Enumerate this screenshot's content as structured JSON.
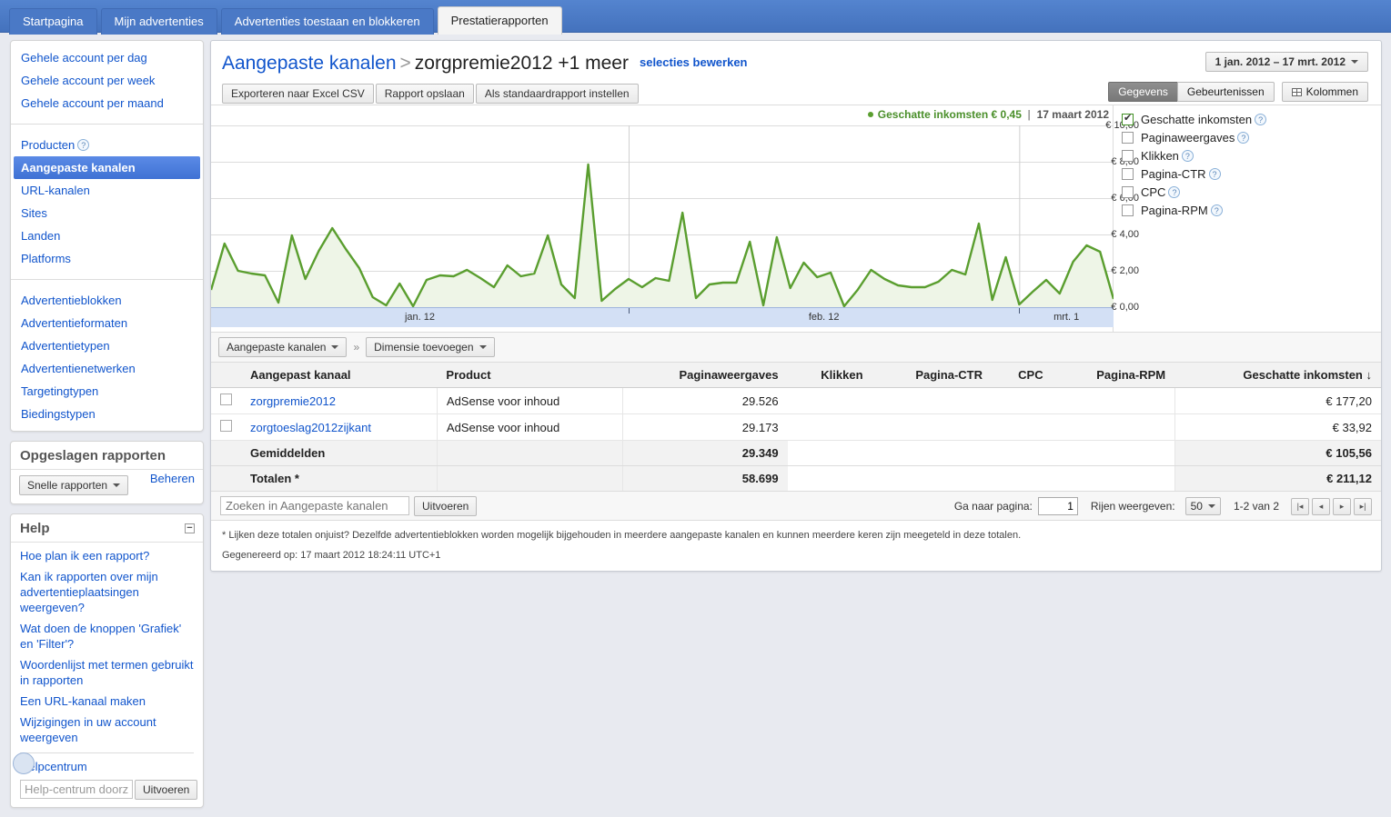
{
  "tabs": [
    {
      "label": "Startpagina",
      "active": false
    },
    {
      "label": "Mijn advertenties",
      "active": false
    },
    {
      "label": "Advertenties toestaan en blokkeren",
      "active": false
    },
    {
      "label": "Prestatierapporten",
      "active": true
    }
  ],
  "sidebar": {
    "nav_group1": [
      {
        "label": "Gehele account per dag"
      },
      {
        "label": "Gehele account per week"
      },
      {
        "label": "Gehele account per maand"
      }
    ],
    "nav_group2": [
      {
        "label": "Producten",
        "help": true
      },
      {
        "label": "Aangepaste kanalen",
        "selected": true
      },
      {
        "label": "URL-kanalen"
      },
      {
        "label": "Sites"
      },
      {
        "label": "Landen"
      },
      {
        "label": "Platforms"
      }
    ],
    "nav_group3": [
      {
        "label": "Advertentieblokken"
      },
      {
        "label": "Advertentieformaten"
      },
      {
        "label": "Advertentietypen"
      },
      {
        "label": "Advertentienetwerken"
      },
      {
        "label": "Targetingtypen"
      },
      {
        "label": "Biedingstypen"
      }
    ],
    "saved_reports": {
      "title": "Opgeslagen rapporten",
      "manage_label": "Beheren",
      "quick_reports_label": "Snelle rapporten"
    },
    "help": {
      "title": "Help",
      "links": [
        "Hoe plan ik een rapport?",
        "Kan ik rapporten over mijn advertentieplaatsingen weergeven?",
        "Wat doen de knoppen 'Grafiek' en 'Filter'?",
        "Woordenlijst met termen gebruikt in rapporten",
        "Een URL-kanaal maken",
        "Wijzigingen in uw account weergeven"
      ],
      "helpcentrum_label": "Helpcentrum",
      "search_placeholder": "Help-centrum doorzoeken",
      "search_button": "Uitvoeren"
    }
  },
  "header": {
    "breadcrumb_root": "Aangepaste kanalen",
    "breadcrumb_sep": ">",
    "breadcrumb_current": "zorgpremie2012 +1 meer",
    "edit_selections": "selecties bewerken",
    "buttons": [
      "Exporteren naar Excel CSV",
      "Rapport opslaan",
      "Als standaardrapport instellen"
    ],
    "date_range": "1 jan. 2012 – 17 mrt. 2012",
    "view_data": "Gegevens",
    "view_events": "Gebeurtenissen",
    "columns_button": "Kolommen"
  },
  "chart_data": {
    "type": "line",
    "title": "Geschatte inkomsten",
    "title_value": "€ 0,45",
    "title_date": "17 maart 2012",
    "xlabel": "",
    "ylabel": "",
    "ylim": [
      0,
      10
    ],
    "ytick_labels": [
      "€ 10,00",
      "€ 8,00",
      "€ 6,00",
      "€ 4,00",
      "€ 2,00",
      "€ 0,00"
    ],
    "yticks": [
      10,
      8,
      6,
      4,
      2,
      0
    ],
    "xtick_labels": [
      "jan. 12",
      "feb. 12",
      "mrt. 1"
    ],
    "xtick_positions": [
      0,
      31,
      60
    ],
    "grid": true,
    "legend": "none",
    "line_color": "#5a9e2f",
    "fill_color": "#eef5e7",
    "series": [
      {
        "name": "Geschatte inkomsten",
        "values": [
          0.95,
          3.5,
          2.0,
          1.85,
          1.75,
          0.25,
          3.95,
          1.55,
          3.1,
          4.35,
          3.2,
          2.15,
          0.55,
          0.1,
          1.3,
          0.05,
          1.5,
          1.75,
          1.7,
          2.05,
          1.6,
          1.1,
          2.3,
          1.7,
          1.85,
          3.95,
          1.25,
          0.5,
          7.85,
          0.35,
          1.0,
          1.55,
          1.1,
          1.6,
          1.45,
          5.2,
          0.5,
          1.25,
          1.35,
          1.35,
          3.6,
          0.1,
          3.85,
          1.05,
          2.45,
          1.65,
          1.9,
          0.05,
          0.95,
          2.05,
          1.55,
          1.2,
          1.1,
          1.1,
          1.4,
          2.05,
          1.8,
          4.6,
          0.4,
          2.75,
          0.15,
          0.85,
          1.5,
          0.75,
          2.5,
          3.4,
          3.05,
          0.45
        ]
      }
    ]
  },
  "metrics": [
    {
      "label": "Geschatte inkomsten",
      "checked": true,
      "help": true
    },
    {
      "label": "Paginaweergaves",
      "checked": false,
      "help": true
    },
    {
      "label": "Klikken",
      "checked": false,
      "help": true
    },
    {
      "label": "Pagina-CTR",
      "checked": false,
      "help": true
    },
    {
      "label": "CPC",
      "checked": false,
      "help": true
    },
    {
      "label": "Pagina-RPM",
      "checked": false,
      "help": true
    }
  ],
  "dimension_bar": {
    "primary": "Aangepaste kanalen",
    "separator": "»",
    "add_dimension": "Dimensie toevoegen"
  },
  "table": {
    "columns": [
      {
        "label": "Aangepast kanaal",
        "align": "left"
      },
      {
        "label": "Product",
        "align": "left"
      },
      {
        "label": "Paginaweergaves",
        "align": "right"
      },
      {
        "label": "Klikken",
        "align": "right"
      },
      {
        "label": "Pagina-CTR",
        "align": "right"
      },
      {
        "label": "CPC",
        "align": "right"
      },
      {
        "label": "Pagina-RPM",
        "align": "right"
      },
      {
        "label": "Geschatte inkomsten ↓",
        "align": "right"
      }
    ],
    "rows": [
      {
        "channel": "zorgpremie2012",
        "product": "AdSense voor inhoud",
        "pageviews": "29.526",
        "clicks": "",
        "page_ctr": "",
        "cpc": "",
        "page_rpm": "",
        "est_earnings": "€ 177,20"
      },
      {
        "channel": "zorgtoeslag2012zijkant",
        "product": "AdSense voor inhoud",
        "pageviews": "29.173",
        "clicks": "",
        "page_ctr": "",
        "cpc": "",
        "page_rpm": "",
        "est_earnings": "€ 33,92"
      }
    ],
    "summary": [
      {
        "label": "Gemiddelden",
        "product": "",
        "pageviews": "29.349",
        "clicks": "",
        "page_ctr": "",
        "cpc": "",
        "page_rpm": "",
        "est_earnings": "€ 105,56"
      },
      {
        "label": "Totalen *",
        "product": "",
        "pageviews": "58.699",
        "clicks": "",
        "page_ctr": "",
        "cpc": "",
        "page_rpm": "",
        "est_earnings": "€ 211,12"
      }
    ]
  },
  "table_footer": {
    "search_placeholder": "Zoeken in Aangepaste kanalen",
    "search_button": "Uitvoeren",
    "goto_page_label": "Ga naar pagina:",
    "page_value": "1",
    "rows_label": "Rijen weergeven:",
    "rows_value": "50",
    "range": "1-2 van 2"
  },
  "notes": {
    "footnote": "* Lijken deze totalen onjuist? Dezelfde advertentieblokken worden mogelijk bijgehouden in meerdere aangepaste kanalen en kunnen meerdere keren zijn meegeteld in deze totalen.",
    "generated": "Gegenereerd op: 17 maart 2012 18:24:11 UTC+1"
  }
}
